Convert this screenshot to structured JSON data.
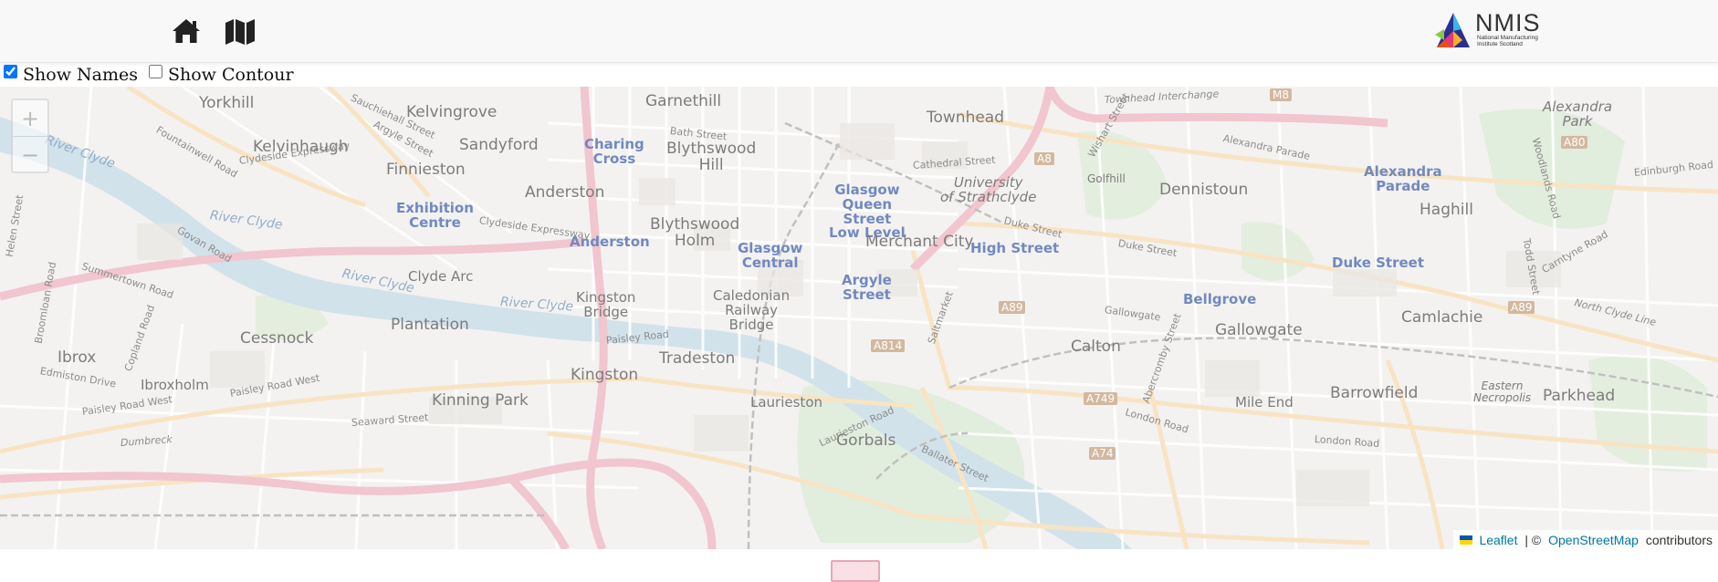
{
  "navbar": {
    "home_icon": "home-icon",
    "map_icon": "map-icon",
    "logo": {
      "title": "NMIS",
      "sub_line1": "National Manufacturing",
      "sub_line2": "Institute Scotland"
    }
  },
  "controls": {
    "show_names_label": "Show Names",
    "show_names_checked": true,
    "show_contour_label": "Show Contour",
    "show_contour_checked": false
  },
  "map": {
    "zoom_in": "+",
    "zoom_out": "−",
    "places": {
      "yorkhill": "Yorkhill",
      "kelvingrove": "Kelvingrove",
      "garnethill": "Garnethill",
      "townhead": "Townhead",
      "kelvinhaugh": "Kelvinhaugh",
      "sandyford": "Sandyford",
      "charing_cross": "Charing\nCross",
      "blythswood_hill": "Blythswood\nHill",
      "finnieston": "Finnieston",
      "anderston": "Anderston",
      "exhibition_centre": "Exhibition\nCentre",
      "blythswood_holm": "Blythswood\nHolm",
      "anderston_st": "Anderston",
      "glasgow_central": "Glasgow\nCentral",
      "glasgow_queen_street": "Glasgow\nQueen\nStreet\nLow Level",
      "merchant_city": "Merchant City",
      "high_street": "High Street",
      "university": "University\nof Strathclyde",
      "dennistoun": "Dennistoun",
      "alexandra_parade": "Alexandra\nParade",
      "haghill": "Haghill",
      "alexandra_park": "Alexandra\nPark",
      "duke_street_st": "Duke Street",
      "clyde_arc": "Clyde Arc",
      "kingston_bridge": "Kingston\nBridge",
      "caledonian_railway_bridge": "Caledonian\nRailway\nBridge",
      "argyle_street": "Argyle\nStreet",
      "plantation": "Plantation",
      "cessnock": "Cessnock",
      "ibrox": "Ibrox",
      "ibroxholm": "Ibroxholm",
      "kingston": "Kingston",
      "tradeston": "Tradeston",
      "kinning_park": "Kinning Park",
      "laurieston": "Laurieston",
      "gorbals": "Gorbals",
      "calton": "Calton",
      "bellgrove": "Bellgrove",
      "gallowgate": "Gallowgate",
      "camlachie": "Camlachie",
      "barrowfield": "Barrowfield",
      "mile_end": "Mile End",
      "parkhead": "Parkhead",
      "eastern_necropolis": "Eastern\nNecropolis",
      "golfhill": "Golfhill"
    },
    "roads": {
      "townhead_interchange": "Townhead Interchange",
      "bath_street": "Bath Street",
      "cathedral_street": "Cathedral Street",
      "alexandra_parade_rd": "Alexandra Parade",
      "edinburgh_road": "Edinburgh Road",
      "duke_street_rd": "Duke Street",
      "duke_street_rd2": "Duke Street",
      "clydeside_expressway": "Clydeside Expressway",
      "clydeside_expressway2": "Clydeside Expressway",
      "sauchiehall_street": "Sauchiehall Street",
      "argyle_street_rd": "Argyle Street",
      "govan_road": "Govan Road",
      "summertown_road": "Summertown Road",
      "paisley_road": "Paisley Road",
      "paisley_road_west": "Paisley Road West",
      "paisley_road_west2": "Paisley Road West",
      "edmiston_drive": "Edmiston Drive",
      "seaward_street": "Seaward Street",
      "london_road": "London Road",
      "london_road2": "London Road",
      "gallowgate_rd": "Gallowgate",
      "north_clyde_line": "North Clyde Line",
      "carntyne_road": "Carntyne Road",
      "wishart_street": "Wishart Street",
      "abercromby_street": "Abercromby Street",
      "saltmarket": "Saltmarket",
      "ballater_street": "Ballater Street",
      "laurieston_road": "Laurieston Road",
      "dumbreck_road": "Dumbreck",
      "copland_road": "Copland Road",
      "broomloan_road": "Broomloan Road",
      "helen_street": "Helen Street",
      "todd_street": "Todd Street",
      "fountainwell_road": "Fountainwell Road",
      "woodlands_road": "Woodlands Road",
      "river_clyde_1": "River Clyde",
      "river_clyde_2": "River Clyde",
      "river_clyde_3": "River Clyde",
      "river_clyde_4": "River Clyde"
    },
    "shields": {
      "m8": "M8",
      "a8": "A8",
      "a80": "A80",
      "a89": "A89",
      "a89b": "A89",
      "a814": "A814",
      "a749": "A749",
      "a74": "A74"
    },
    "attribution": {
      "leaflet": "Leaflet",
      "separator": " | © ",
      "osm": "OpenStreetMap",
      "suffix": " contributors"
    }
  },
  "colors": {
    "motorway": "#e9a3b0",
    "primary": "#f4d4a0",
    "water": "#b5d0df",
    "park": "#cfe3c8",
    "land": "#ecebe7"
  }
}
